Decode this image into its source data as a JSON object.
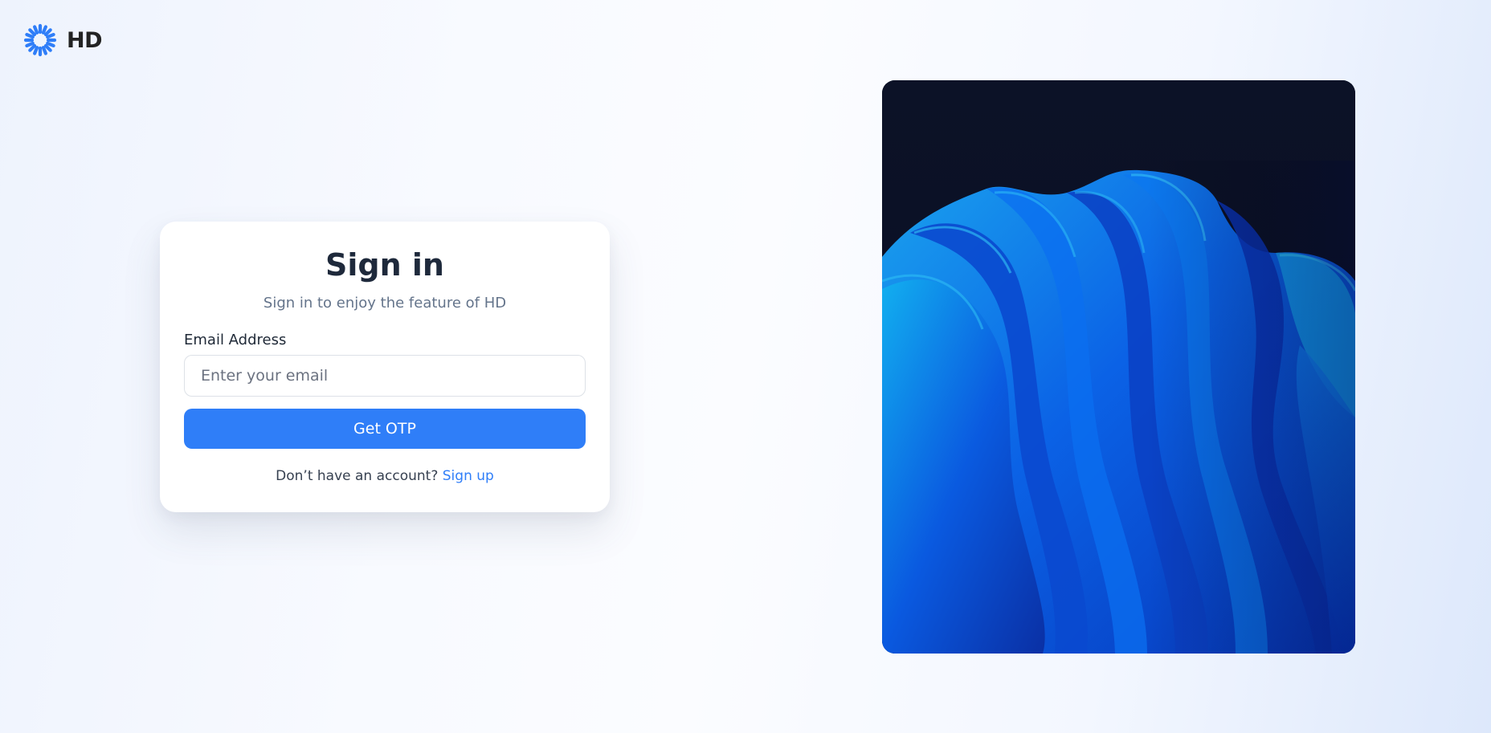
{
  "brand": {
    "name": "HD",
    "icon": "sunburst-icon",
    "color": "#2f7ef8"
  },
  "signin": {
    "title": "Sign in",
    "subtitle": "Sign in to enjoy the feature of HD",
    "email_label": "Email Address",
    "email_placeholder": "Enter your email",
    "email_value": "",
    "submit_label": "Get OTP",
    "no_account_text": "Don’t have an account?",
    "signup_label": "Sign up"
  },
  "hero_image": {
    "description": "abstract blue wave artwork",
    "colors": {
      "background": "#0b1128",
      "primary": "#0a5ee8",
      "highlight": "#11b4f0"
    }
  },
  "theme": {
    "accent": "#2f7ef8",
    "title_color": "#1e293b",
    "muted_text": "#64748b"
  }
}
